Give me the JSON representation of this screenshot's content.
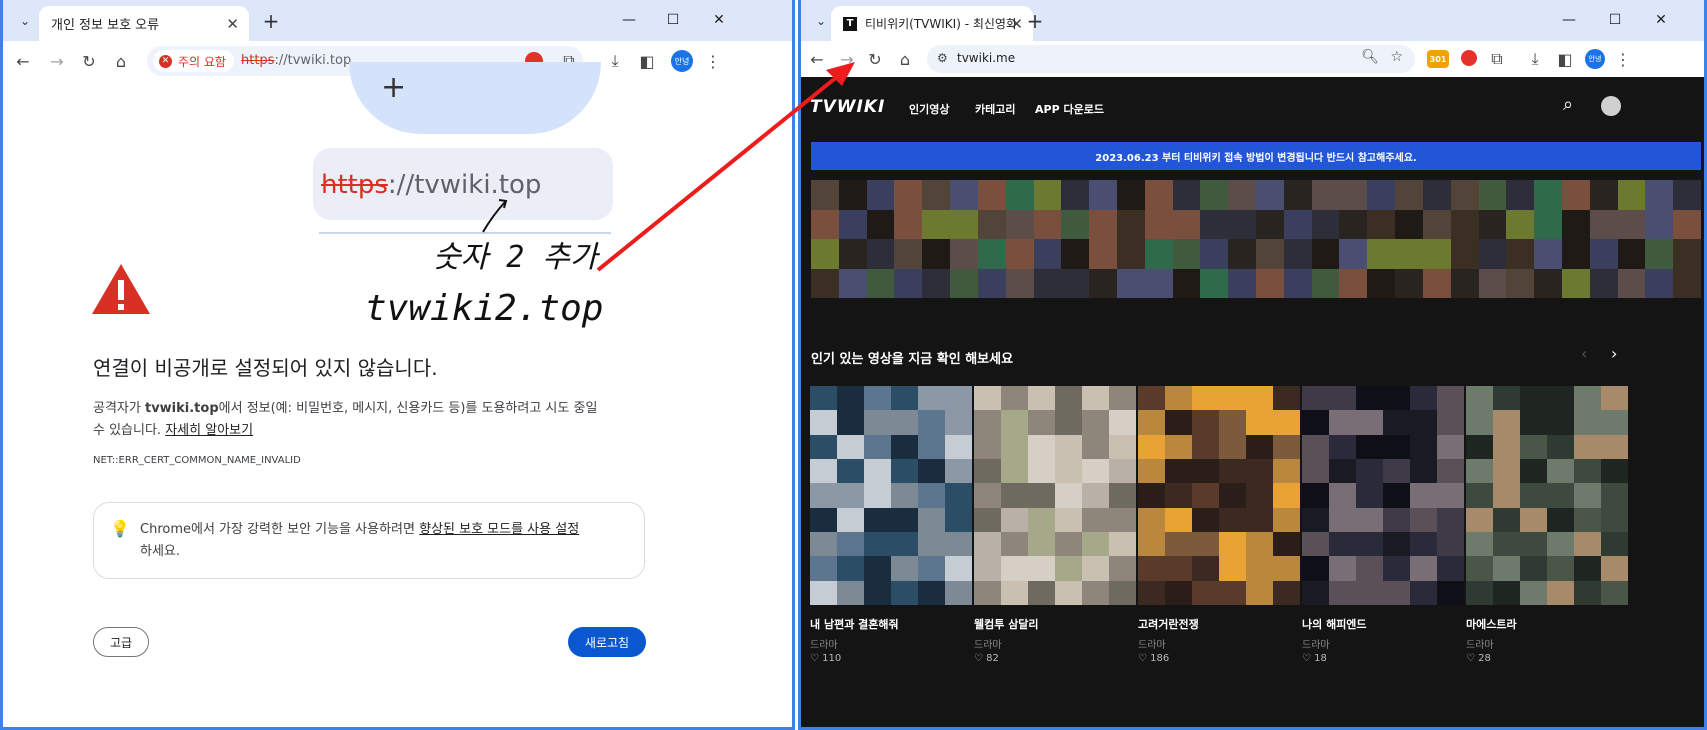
{
  "left": {
    "tab_title": "개인 정보 보호 오류",
    "security_chip": "주의 요함",
    "url_scheme": "https",
    "url_rest": "://tvwiki.top",
    "avatar_label": "안녕",
    "zoom_url_scheme": "https",
    "zoom_url_rest": "://tvwiki.top",
    "heading": "연결이 비공개로 설정되어 있지 않습니다.",
    "body_prefix": "공격자가 ",
    "body_domain": "tvwiki.top",
    "body_suffix": "에서 정보(예: 비밀번호, 메시지, 신용카드 등)를 도용하려고 시도 중일",
    "body_line2": "수 있습니다.",
    "learn_more": "자세히 알아보기",
    "error_code": "NET::ERR_CERT_COMMON_NAME_INVALID",
    "tip_prefix": "Chrome에서 가장 강력한 보안 기능을 사용하려면 ",
    "tip_link": "향상된 보호 모드를 사용 설정",
    "tip_suffix": "하세요.",
    "advanced_button": "고급",
    "reload_button": "새로고침",
    "annotation_note": "숫자 2 추가",
    "annotation_url": "tvwiki2.top"
  },
  "right": {
    "tab_title": "티비위키(TVWIKI) - 최신영화",
    "url": "tvwiki.me",
    "ext_badge": "301",
    "avatar_label": "안녕",
    "logo": "TVWIKI",
    "nav": [
      "인기영상",
      "카테고리",
      "APP 다운로드"
    ],
    "banner": "2023.06.23 부터 티비위키 접속 방법이 변경됩니다 반드시 참고해주세요.",
    "section_title": "인기 있는 영상을 지금 확인 해보세요",
    "cards": [
      {
        "title": "내 남편과 결혼해줘",
        "genre": "드라마",
        "likes": "110"
      },
      {
        "title": "웰컴투 삼달리",
        "genre": "드라마",
        "likes": "82"
      },
      {
        "title": "고려거란전쟁",
        "genre": "드라마",
        "likes": "186"
      },
      {
        "title": "나의 해피엔드",
        "genre": "드라마",
        "likes": "18"
      },
      {
        "title": "마에스트라",
        "genre": "드라마",
        "likes": "28"
      }
    ]
  },
  "colors": {
    "accent": "#3e82e8",
    "warning_red": "#d93025",
    "reload_blue": "#0b57d0",
    "banner_blue": "#2355d8",
    "annotation_arrow": "#ee1c1c"
  },
  "icons": [
    "chevron-down-icon",
    "close-icon",
    "plus-icon",
    "back-arrow-icon",
    "forward-arrow-icon",
    "reload-icon",
    "home-icon",
    "puzzle-icon",
    "download-icon",
    "sidepanel-icon",
    "kebab-icon",
    "warning-triangle-icon",
    "lightbulb-icon",
    "search-icon",
    "star-icon",
    "user-icon",
    "heart-icon"
  ]
}
